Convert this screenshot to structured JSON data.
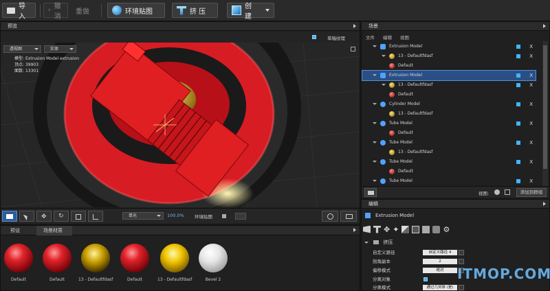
{
  "toolbar": {
    "import": "导入",
    "undo": "撤消",
    "redo": "重做",
    "env_map": "环境贴图",
    "extrude": "挤 压",
    "create": "创 建"
  },
  "preview": {
    "title": "预览",
    "grass_label": "草稿纹理",
    "dropdown1": "透视图",
    "dropdown2": "实体",
    "info_name_label": "模型:",
    "info_name": "Extrusion Model extrusion",
    "info_verts_label": "顶点:",
    "info_verts": "39903",
    "info_faces_label": "面数:",
    "info_faces": "13301"
  },
  "viewport_bar": {
    "light": "单光",
    "zoom": "100.0%",
    "env_label": "环境贴图"
  },
  "materials": {
    "tab1": "预设",
    "tab2": "场景材质",
    "items": [
      "Default",
      "Default",
      "13 - Defaultfdasf",
      "Default",
      "13 - Defaultfdasf",
      "Bevel 2"
    ]
  },
  "scene": {
    "title": "场景",
    "menu": [
      "文件",
      "编辑",
      "视图"
    ],
    "rows": [
      "Extrusion Model",
      "13 - Defaultfdasf",
      "Default",
      "Extrusion Model",
      "13 - Defaultfdasf",
      "Default",
      "Cylinder Model",
      "13 - Defaultfdasf",
      "Tube Model",
      "Default",
      "Tube Model",
      "13 - Defaultfdasf",
      "Tube Model",
      "Default",
      "Tube Model"
    ],
    "view_label": "视图:",
    "add_group": "添加到群组",
    "x": "X"
  },
  "edit": {
    "title": "编辑",
    "object": "Extrusion Model",
    "section": "挤压",
    "props": [
      {
        "label": "自定义路径",
        "value": "自定义路径 4"
      },
      {
        "label": "剖角副本",
        "value": "2"
      },
      {
        "label": "偏移模式",
        "value": "绝对"
      },
      {
        "label": "分离对象",
        "value": ""
      },
      {
        "label": "分离模式",
        "value": "通过几何体 (是)"
      }
    ]
  },
  "watermark": "ITMOP.COM"
}
